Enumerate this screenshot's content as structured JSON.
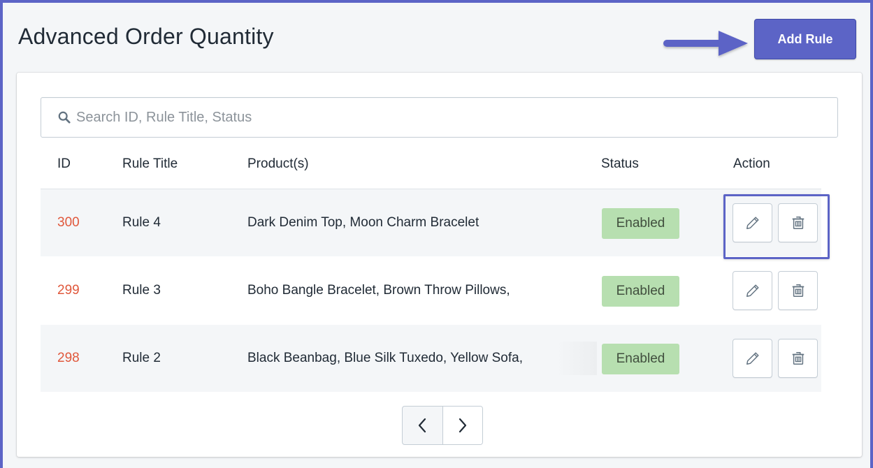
{
  "page": {
    "title": "Advanced Order Quantity"
  },
  "header": {
    "add_rule_label": "Add Rule"
  },
  "search": {
    "placeholder": "Search ID, Rule Title, Status",
    "value": ""
  },
  "table": {
    "columns": [
      "ID",
      "Rule Title",
      "Product(s)",
      "Status",
      "Action"
    ],
    "rows": [
      {
        "id": "300",
        "title": "Rule 4",
        "products": "Dark Denim Top, Moon Charm Bracelet",
        "status": "Enabled"
      },
      {
        "id": "299",
        "title": "Rule 3",
        "products": "Boho Bangle Bracelet, Brown Throw Pillows,",
        "status": "Enabled"
      },
      {
        "id": "298",
        "title": "Rule 2",
        "products": "Black Beanbag, Blue Silk Tuxedo, Yellow Sofa,",
        "status": "Enabled"
      }
    ]
  },
  "icons": {
    "search": "search-icon",
    "edit": "pencil-icon",
    "delete": "trash-icon",
    "prev": "chevron-left-icon",
    "next": "chevron-right-icon",
    "annotation": "arrow-right-annotation"
  },
  "colors": {
    "accent": "#5c64c6",
    "id_text": "#e0583c",
    "status_enabled_bg": "#b7dfb0"
  }
}
